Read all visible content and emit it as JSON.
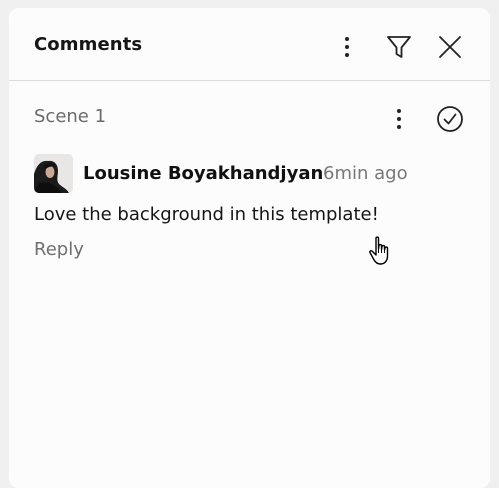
{
  "header": {
    "title": "Comments",
    "icons": [
      "more-vertical-icon",
      "filter-icon",
      "close-icon"
    ]
  },
  "scene": {
    "title": "Scene 1",
    "icons": [
      "more-vertical-icon",
      "check-circle-icon"
    ]
  },
  "comment": {
    "author": "Lousine Boyakhandjyan",
    "time": "6min ago",
    "text": "Love the background in this template!",
    "reply_label": "Reply"
  },
  "colors": {
    "panel_bg": "#fcfcfc",
    "outer_bg": "#f0f0f1",
    "text_primary": "#151515",
    "text_muted": "#6f6f6f",
    "divider": "#dcdcdc"
  }
}
